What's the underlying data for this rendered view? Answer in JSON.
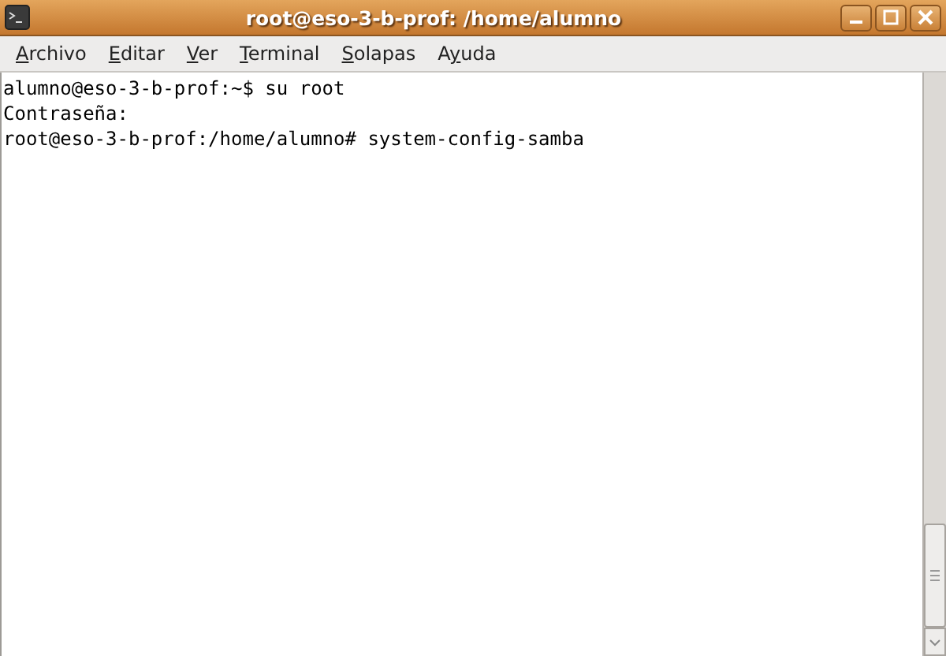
{
  "window": {
    "title": "root@eso-3-b-prof: /home/alumno"
  },
  "menu": [
    {
      "key": "A",
      "after": "rchivo"
    },
    {
      "key": "E",
      "after": "ditar"
    },
    {
      "key": "V",
      "after": "er"
    },
    {
      "key": "T",
      "after": "erminal"
    },
    {
      "key": "S",
      "after": "olapas"
    },
    {
      "before": "A",
      "key": "y",
      "after": "uda"
    }
  ],
  "terminal": {
    "lines": [
      "alumno@eso-3-b-prof:~$ su root",
      "Contraseña:",
      "root@eso-3-b-prof:/home/alumno# system-config-samba"
    ]
  }
}
